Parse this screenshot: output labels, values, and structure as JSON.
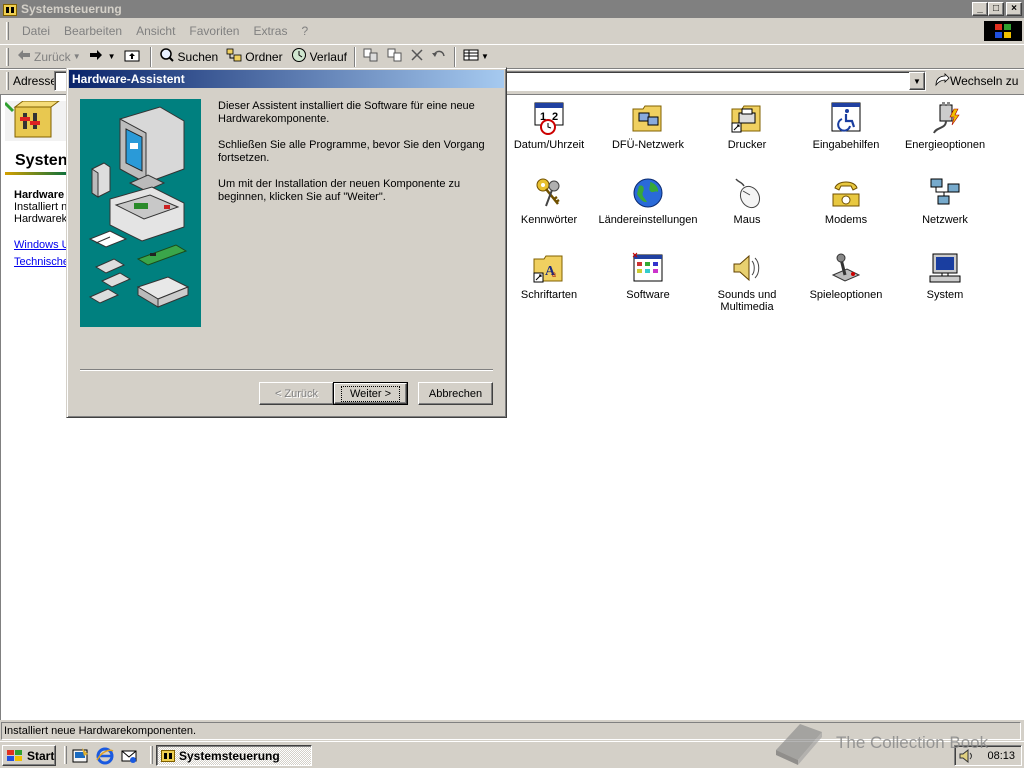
{
  "window": {
    "title": "Systemsteuerung",
    "controls": [
      "_",
      "□",
      "×"
    ]
  },
  "menu": [
    {
      "label": "Datei"
    },
    {
      "label": "Bearbeiten"
    },
    {
      "label": "Ansicht"
    },
    {
      "label": "Favoriten"
    },
    {
      "label": "Extras"
    },
    {
      "label": "?"
    }
  ],
  "toolbar": {
    "back_label": "Zurück",
    "forward_label": "",
    "search_label": "Suchen",
    "folders_label": "Ordner",
    "history_label": "Verlauf"
  },
  "address": {
    "label": "Adresse",
    "value": "",
    "go_label": "Wechseln zu"
  },
  "leftpane": {
    "title": "Systemsteuerung",
    "title_visible": "Systen",
    "item_title": "Hardware",
    "desc1": "Installiert n",
    "desc2": "Hardwarek",
    "link1": "Windows U",
    "link2": "Technische"
  },
  "icons": [
    {
      "label": "Datum/Uhrzeit",
      "icon": "calendar-clock-icon"
    },
    {
      "label": "DFÜ-Netzwerk",
      "icon": "dialup-network-folder-icon"
    },
    {
      "label": "Drucker",
      "icon": "printer-folder-icon"
    },
    {
      "label": "Eingabehilfen",
      "icon": "accessibility-icon"
    },
    {
      "label": "Energieoptionen",
      "icon": "power-plug-icon"
    },
    {
      "label": "Kennwörter",
      "icon": "keys-icon"
    },
    {
      "label": "Ländereinstellungen",
      "icon": "globe-icon"
    },
    {
      "label": "Maus",
      "icon": "mouse-icon"
    },
    {
      "label": "Modems",
      "icon": "telephone-modem-icon"
    },
    {
      "label": "Netzwerk",
      "icon": "network-computers-icon"
    },
    {
      "label": "Schriftarten",
      "icon": "fonts-folder-icon"
    },
    {
      "label": "Software",
      "icon": "software-icon"
    },
    {
      "label": "Sounds und Multimedia",
      "icon": "speaker-icon"
    },
    {
      "label": "Spieleoptionen",
      "icon": "joystick-icon"
    },
    {
      "label": "System",
      "icon": "computer-icon"
    }
  ],
  "status": {
    "text": "Installiert neue Hardwarekomponenten."
  },
  "dialog": {
    "title": "Hardware-Assistent",
    "paragraphs": [
      "Dieser Assistent installiert die Software für eine neue Hardwarekomponente.",
      "Schließen Sie alle Programme, bevor Sie den Vorgang fortsetzen.",
      "Um mit der Installation der neuen Komponente zu beginnen, klicken Sie auf \"Weiter\"."
    ],
    "back_label": "< Zurück",
    "next_label": "Weiter >",
    "cancel_label": "Abbrechen"
  },
  "taskbar": {
    "start_label": "Start",
    "task_label": "Systemsteuerung",
    "clock": "08:13"
  },
  "watermark": {
    "text": "The Collection Book"
  },
  "colors": {
    "titlebar_inactive": "#808080",
    "dialog_title_start": "#0a246a",
    "dialog_title_end": "#a6caf0",
    "face": "#d4d0c8",
    "wizard_bg": "#00807f",
    "link": "#0000ee"
  }
}
